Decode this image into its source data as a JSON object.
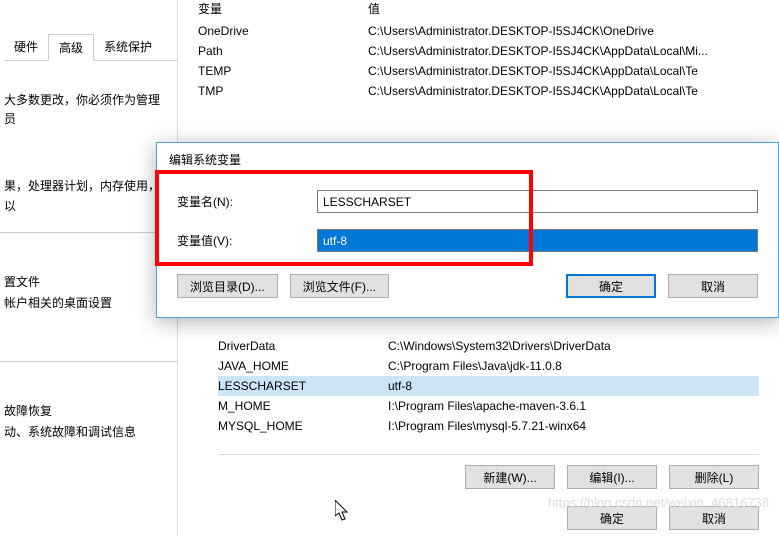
{
  "left": {
    "tabs": [
      "硬件",
      "高级",
      "系统保护"
    ],
    "note": "大多数更改，你必须作为管理员",
    "perf_line": "果，处理器计划，内存使用，以",
    "section1_title": "置文件",
    "section1_text": "帐户相关的桌面设置",
    "section2_title": "故障恢复",
    "section2_text": "动、系统故障和调试信息"
  },
  "upper_header": {
    "name": "变量",
    "value": "值"
  },
  "upper_env": [
    {
      "name": "OneDrive",
      "value": "C:\\Users\\Administrator.DESKTOP-I5SJ4CK\\OneDrive"
    },
    {
      "name": "Path",
      "value": "C:\\Users\\Administrator.DESKTOP-I5SJ4CK\\AppData\\Local\\Mi..."
    },
    {
      "name": "TEMP",
      "value": "C:\\Users\\Administrator.DESKTOP-I5SJ4CK\\AppData\\Local\\Te"
    },
    {
      "name": "TMP",
      "value": "C:\\Users\\Administrator.DESKTOP-I5SJ4CK\\AppData\\Local\\Te"
    }
  ],
  "dialog": {
    "title": "编辑系统变量",
    "name_label": "变量名(N):",
    "name_value": "LESSCHARSET",
    "value_label": "变量值(V):",
    "value_value": "utf-8",
    "browse_dir": "浏览目录(D)...",
    "browse_file": "浏览文件(F)...",
    "ok": "确定",
    "cancel": "取消"
  },
  "lower_env": [
    {
      "name": "DriverData",
      "value": "C:\\Windows\\System32\\Drivers\\DriverData"
    },
    {
      "name": "JAVA_HOME",
      "value": "C:\\Program Files\\Java\\jdk-11.0.8"
    },
    {
      "name": "LESSCHARSET",
      "value": "utf-8",
      "selected": true
    },
    {
      "name": "M_HOME",
      "value": "I:\\Program Files\\apache-maven-3.6.1"
    },
    {
      "name": "MYSQL_HOME",
      "value": "I:\\Program Files\\mysql-5.7.21-winx64"
    }
  ],
  "lower_buttons": {
    "new": "新建(W)...",
    "edit": "编辑(I)...",
    "delete": "删除(L)"
  },
  "bottom": {
    "ok": "确定",
    "cancel": "取消"
  },
  "watermark": "https://blog.csdn.net/weixin_46816738"
}
